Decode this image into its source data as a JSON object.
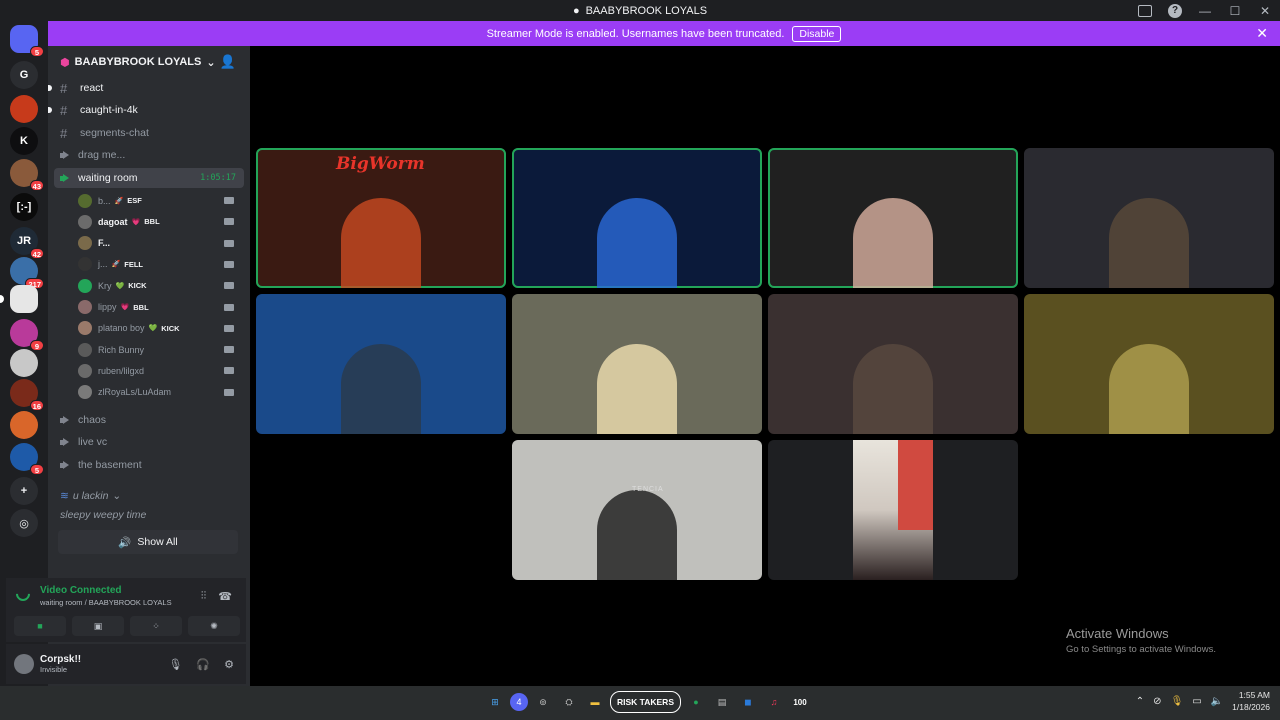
{
  "window": {
    "title": "BAABYBROOK LOYALS"
  },
  "banner": {
    "text": "Streamer Mode is enabled. Usernames have been truncated.",
    "button": "Disable"
  },
  "rail": {
    "servers": [
      {
        "name": "discord-home",
        "label": "",
        "color": "#5865f2",
        "badge": "5"
      },
      {
        "name": "server-g",
        "label": "G",
        "color": "#2b2d31",
        "badge": ""
      },
      {
        "name": "server-red",
        "label": "",
        "color": "#c73a1b",
        "badge": ""
      },
      {
        "name": "server-kick",
        "label": "K",
        "color": "#0e0e10",
        "badge": ""
      },
      {
        "name": "server-avatar",
        "label": "",
        "color": "#8a5a3b",
        "badge": "43"
      },
      {
        "name": "server-bracket",
        "label": "[:-]",
        "color": "#0b0b0b",
        "badge": ""
      },
      {
        "name": "server-jr",
        "label": "JR",
        "color": "#1f2a36",
        "badge": "42"
      },
      {
        "name": "server-sky",
        "label": "",
        "color": "#3a6fa8",
        "badge": "217"
      },
      {
        "name": "server-baabybrook",
        "label": "",
        "color": "#e6e6e6",
        "badge": ""
      },
      {
        "name": "server-stream",
        "label": "",
        "color": "#b93a9a",
        "badge": "9"
      },
      {
        "name": "server-white",
        "label": "",
        "color": "#c8c8c8",
        "badge": ""
      },
      {
        "name": "server-fire",
        "label": "",
        "color": "#7a2a1a",
        "badge": "16"
      },
      {
        "name": "server-orange",
        "label": "",
        "color": "#d9662a",
        "badge": ""
      },
      {
        "name": "server-blue",
        "label": "",
        "color": "#1e5aa8",
        "badge": "5"
      }
    ]
  },
  "sidebar": {
    "server_name": "BAABYBROOK LOYALS",
    "channels": [
      {
        "name": "react",
        "type": "text",
        "state": "unread"
      },
      {
        "name": "caught-in-4k",
        "type": "text",
        "state": "unread"
      },
      {
        "name": "segments-chat",
        "type": "text",
        "state": "normal"
      },
      {
        "name": "drag me...",
        "type": "voice",
        "state": "normal"
      },
      {
        "name": "waiting room",
        "type": "voice",
        "state": "active",
        "timer": "1:05:17"
      }
    ],
    "voice_users": [
      {
        "name": "b...",
        "tag": "ESF",
        "emoji": "🚀",
        "color": "#556b2f"
      },
      {
        "name": "dagoat",
        "tag": "BBL",
        "emoji": "💗",
        "color": "#6b6b6b",
        "bold": true
      },
      {
        "name": "F...",
        "tag": "",
        "emoji": "",
        "color": "#7a6a4a",
        "bold": true
      },
      {
        "name": "j...",
        "tag": "FELL",
        "emoji": "🚀",
        "color": "#333"
      },
      {
        "name": "Kry",
        "tag": "KICK",
        "emoji": "💚",
        "color": "#23a559"
      },
      {
        "name": "lippy",
        "tag": "BBL",
        "emoji": "💗",
        "color": "#8a6a6a"
      },
      {
        "name": "platano boy",
        "tag": "KICK",
        "emoji": "💚",
        "color": "#9a7a6a"
      },
      {
        "name": "Rich Bunny",
        "tag": "",
        "emoji": "",
        "color": "#5a5a5a"
      },
      {
        "name": "ruben/lilgxd",
        "tag": "",
        "emoji": "",
        "color": "#6a6a6a"
      },
      {
        "name": "zlRoyaLs/LuAdam",
        "tag": "",
        "emoji": "",
        "color": "#7a7a7a"
      }
    ],
    "more_channels": [
      {
        "name": "chaos"
      },
      {
        "name": "live vc"
      },
      {
        "name": "the basement"
      }
    ],
    "category": "u lackin",
    "category_channel": "sleepy weepy time",
    "show_all": "Show All"
  },
  "voice_panel": {
    "status": "Video Connected",
    "location": "waiting room / BAABYBROOK LOYALS"
  },
  "user_panel": {
    "name": "Corpsk!!",
    "status": "Invisible"
  },
  "tiles": [
    {
      "name": "tile-bigworm",
      "speaking": true,
      "bg": "#3a1a12",
      "fg": "#c94a22",
      "label": "BigWorm"
    },
    {
      "name": "tile-girl-glasses",
      "speaking": true,
      "bg": "#0b1a3a",
      "fg": "#2a6ad9",
      "label": ""
    },
    {
      "name": "tile-girl-headset",
      "speaking": true,
      "bg": "#202020",
      "fg": "#d9b0a0",
      "label": ""
    },
    {
      "name": "tile-cowboy",
      "speaking": false,
      "bg": "#2a2a30",
      "fg": "#5a4a3a",
      "label": ""
    },
    {
      "name": "tile-blue-room",
      "speaking": false,
      "bg": "#1a4a8a",
      "fg": "#2a3a4a",
      "label": ""
    },
    {
      "name": "tile-bright-room",
      "speaking": false,
      "bg": "#6a6a5a",
      "fg": "#f0e0b0",
      "label": ""
    },
    {
      "name": "tile-bedroom",
      "speaking": false,
      "bg": "#3a3030",
      "fg": "#5a4a40",
      "label": ""
    },
    {
      "name": "tile-yellow-room",
      "speaking": false,
      "bg": "#5a5020",
      "fg": "#b0a050",
      "label": ""
    },
    {
      "name": "tile-shirt",
      "speaking": false,
      "bg": "#c0c0bc",
      "fg": "#1a1a1a",
      "label": "TENCIA"
    },
    {
      "name": "tile-portrait",
      "speaking": false,
      "bg": "#2a2a2a",
      "fg": "#d04a40",
      "label": ""
    }
  ],
  "watermark": {
    "title": "Activate Windows",
    "subtitle": "Go to Settings to activate Windows."
  },
  "taskbar": {
    "badge": "4",
    "app_label": "RISK TAKERS",
    "music_badge": "100",
    "time": "1:55 AM",
    "date": "1/18/2026"
  }
}
